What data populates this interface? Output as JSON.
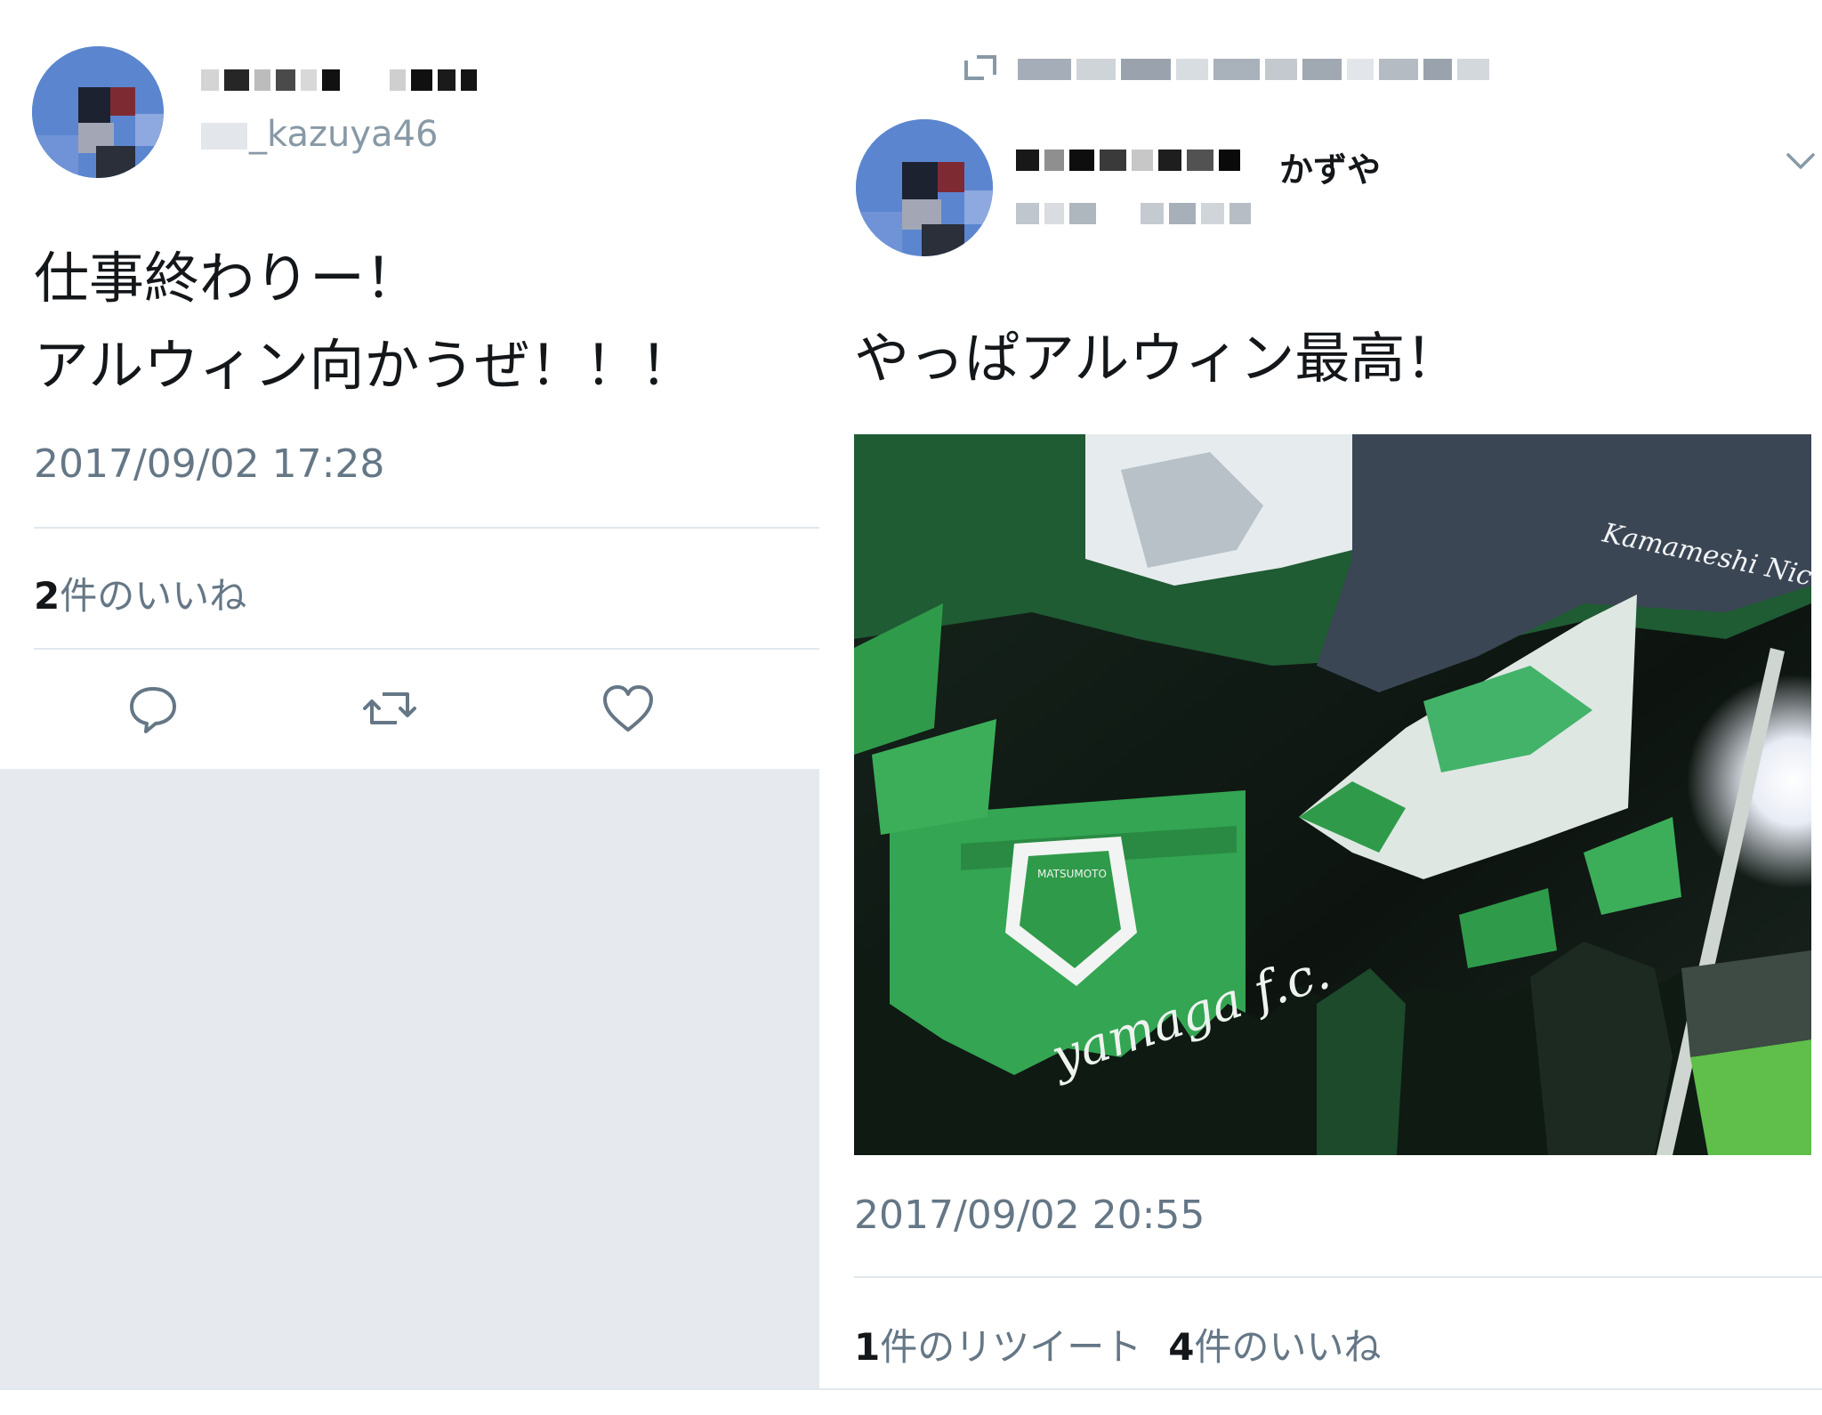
{
  "left_tweet": {
    "display_name": "",
    "handle_visible": "_kazuya46",
    "text": "仕事終わりー！\nアルウィン向かうぜ！！！",
    "timestamp": "2017/09/02 17:28",
    "likes_count": "2",
    "likes_label": "件のいいね",
    "actions": {
      "reply_icon": "reply-icon",
      "retweet_icon": "retweet-icon",
      "like_icon": "heart-icon"
    }
  },
  "right_tweet": {
    "retweeted_by": "",
    "display_name_visible": "かずや",
    "handle_visible": "",
    "text": "やっぱアルウィン最高！",
    "timestamp": "2017/09/02 20:55",
    "retweets_count": "1",
    "retweets_label": "件のリツイート",
    "likes_count": "4",
    "likes_label": "件のいいね",
    "photo_text": {
      "banner_script": "Kamameshi Nice SAKAKI",
      "crest_text": "MATSUMOTO",
      "flag_script": "yamaga f.c."
    }
  },
  "colors": {
    "text_primary": "#14171a",
    "text_secondary": "#657786",
    "divider": "#e1e8ed",
    "empty_area": "#e6e9ee",
    "team_green": "#2f9b4a"
  }
}
